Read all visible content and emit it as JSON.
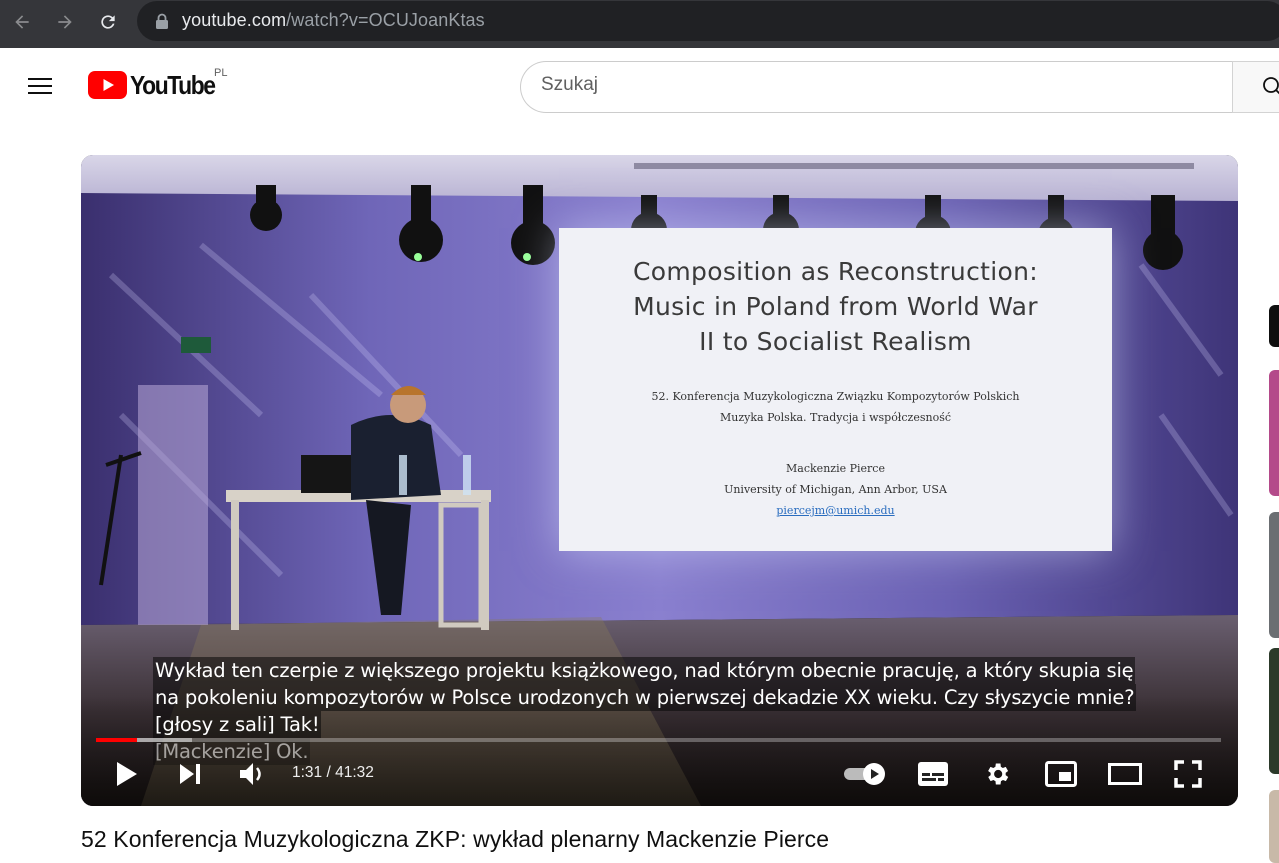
{
  "browser": {
    "url_host": "youtube.com",
    "url_path": "/watch?v=OCUJoanKtas"
  },
  "header": {
    "logo_text": "YouTube",
    "country_code": "PL",
    "search_placeholder": "Szukaj"
  },
  "player": {
    "slide": {
      "title_lines": [
        "Composition as Reconstruction:",
        "Music in Poland from World War",
        "II to Socialist Realism"
      ],
      "conference": "52. Konferencja Muzykologiczna Związku Kompozytorów Polskich",
      "subtitle": "Muzyka Polska. Tradycja i współczesność",
      "speaker": "Mackenzie Pierce",
      "affiliation": "University of Michigan, Ann Arbor, USA",
      "email": "piercejm@umich.edu"
    },
    "captions": [
      "Wykład ten czerpie z większego projektu książkowego, nad którym obecnie pracuję, a który skupia się",
      "na pokoleniu kompozytorów w Polsce urodzonych w pierwszej dekadzie XX wieku. Czy słyszycie mnie?",
      "[głosy z sali] Tak!",
      "[Mackenzie] Ok."
    ],
    "time_display": "1:31 / 41:32",
    "progress_played": 0.0365,
    "progress_buffered": 0.085,
    "autoplay_on": true
  },
  "video": {
    "title": "52 Konferencja Muzykologiczna ZKP: wykład plenarny Mackenzie Pierce"
  },
  "colors": {
    "yt_red": "#ff0000",
    "browser_dark": "#35363a",
    "omnibox": "#202124"
  }
}
